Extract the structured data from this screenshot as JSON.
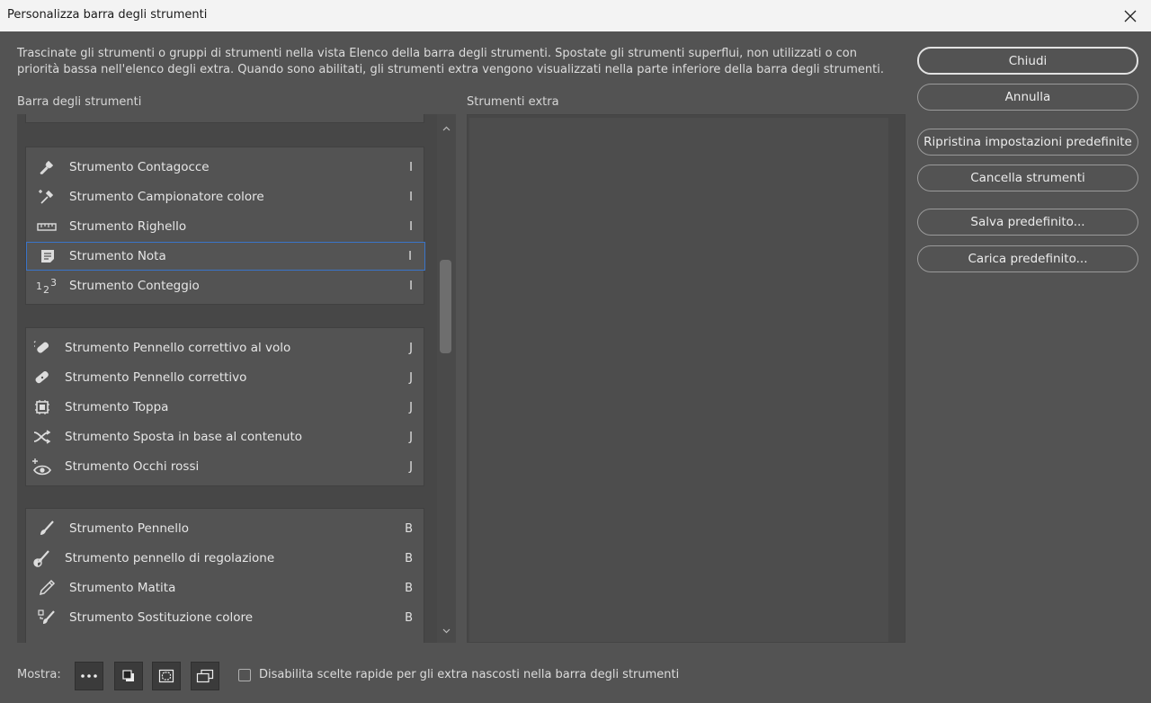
{
  "window": {
    "title": "Personalizza barra degli strumenti",
    "close_glyph": "✕"
  },
  "description": "Trascinate gli strumenti o gruppi di strumenti nella vista Elenco della barra degli strumenti. Spostate gli strumenti superflui, non utilizzati o con priorità bassa nell'elenco degli extra. Quando sono abilitati, gli strumenti extra vengono visualizzati nella parte inferiore della barra degli strumenti.",
  "toolbar_panel": {
    "label": "Barra degli strumenti",
    "groups": [
      {
        "tools": [
          {
            "name": "Strumento Contagocce",
            "key": "I",
            "icon": "eyedropper-icon"
          },
          {
            "name": "Strumento Campionatore colore",
            "key": "I",
            "icon": "color-sampler-icon"
          },
          {
            "name": "Strumento Righello",
            "key": "I",
            "icon": "ruler-icon"
          },
          {
            "name": "Strumento Nota",
            "key": "I",
            "icon": "note-icon"
          },
          {
            "name": "Strumento Conteggio",
            "key": "I",
            "icon": "count-icon"
          }
        ]
      },
      {
        "tools": [
          {
            "name": "Strumento Pennello correttivo al volo",
            "key": "J",
            "icon": "spot-healing-icon"
          },
          {
            "name": "Strumento Pennello correttivo",
            "key": "J",
            "icon": "healing-brush-icon"
          },
          {
            "name": "Strumento Toppa",
            "key": "J",
            "icon": "patch-icon"
          },
          {
            "name": "Strumento Sposta in base al contenuto",
            "key": "J",
            "icon": "content-aware-move-icon"
          },
          {
            "name": "Strumento Occhi rossi",
            "key": "J",
            "icon": "red-eye-icon"
          }
        ]
      },
      {
        "tools": [
          {
            "name": "Strumento Pennello",
            "key": "B",
            "icon": "brush-icon"
          },
          {
            "name": "Strumento pennello di regolazione",
            "key": "B",
            "icon": "adjustment-brush-icon"
          },
          {
            "name": "Strumento Matita",
            "key": "B",
            "icon": "pencil-icon"
          },
          {
            "name": "Strumento Sostituzione colore",
            "key": "B",
            "icon": "color-replacement-icon"
          }
        ]
      }
    ]
  },
  "extra_panel": {
    "label": "Strumenti extra"
  },
  "buttons": {
    "close": "Chiudi",
    "cancel": "Annulla",
    "reset": "Ripristina impostazioni predefinite",
    "clear": "Cancella strumenti",
    "save": "Salva predefinito...",
    "load": "Carica predefinito..."
  },
  "footer": {
    "show_label": "Mostra:",
    "disable_shortcuts_label": "Disabilita scelte rapide per gli extra nascosti nella barra degli strumenti",
    "disable_shortcuts_checked": false
  },
  "colors": {
    "background": "#535353",
    "pane": "#474747",
    "selection": "#3a74c8"
  }
}
